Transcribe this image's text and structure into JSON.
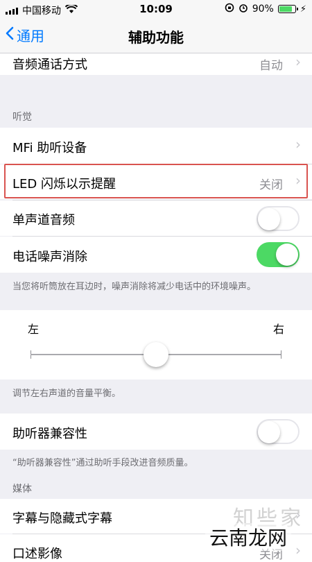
{
  "status_bar": {
    "carrier": "中国移动",
    "time": "10:09",
    "battery_percent": "90%",
    "battery_level": 0.9,
    "icons": [
      "signal-icon",
      "wifi-icon",
      "orientation-lock-icon",
      "alarm-icon",
      "battery-icon",
      "charging-icon"
    ]
  },
  "navbar": {
    "back_label": "通用",
    "title": "辅助功能"
  },
  "rows": {
    "audio_call": {
      "label": "音频通话方式",
      "value": "自动"
    },
    "hearing_header": "听觉",
    "mfi": {
      "label": "MFi 助听设备"
    },
    "led": {
      "label": "LED 闪烁以示提醒",
      "value": "关闭"
    },
    "mono": {
      "label": "单声道音频",
      "on": false
    },
    "noise": {
      "label": "电话噪声消除",
      "on": true
    },
    "noise_footer": "当您将听筒放在耳边时，噪声消除将减少电话中的环境噪声。",
    "balance_left": "左",
    "balance_right": "右",
    "balance_value": 0.5,
    "balance_footer": "调节左右声道的音量平衡。",
    "hac": {
      "label": "助听器兼容性",
      "on": false
    },
    "hac_footer": "“助听器兼容性”通过助听手段改进音频质量。",
    "media_header": "媒体",
    "subtitles": {
      "label": "字幕与隐藏式字幕"
    },
    "audio_desc": {
      "label": "口述影像",
      "value": "关闭"
    }
  },
  "watermark": {
    "line1": "知些家",
    "line2": "云南龙网"
  },
  "colors": {
    "accent": "#007aff",
    "toggle_on": "#4cd964",
    "highlight": "#d9534f"
  }
}
